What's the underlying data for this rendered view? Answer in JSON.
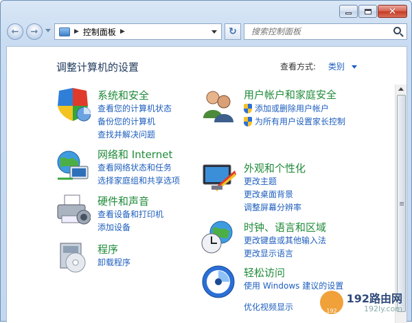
{
  "toolbar": {
    "address_path": "控制面板",
    "search_placeholder": "搜索控制面板"
  },
  "content": {
    "title": "调整计算机的设置",
    "view_by_label": "查看方式:",
    "view_by_value": "类别"
  },
  "categories": {
    "system": {
      "title": "系统和安全",
      "links": [
        "查看您的计算机状态",
        "备份您的计算机",
        "查找并解决问题"
      ]
    },
    "network": {
      "title": "网络和 Internet",
      "links": [
        "查看网络状态和任务",
        "选择家庭组和共享选项"
      ]
    },
    "hardware": {
      "title": "硬件和声音",
      "links": [
        "查看设备和打印机",
        "添加设备"
      ]
    },
    "programs": {
      "title": "程序",
      "links": [
        "卸载程序"
      ]
    },
    "users": {
      "title": "用户帐户和家庭安全",
      "links": [
        "添加或删除用户帐户",
        "为所有用户设置家长控制"
      ]
    },
    "appearance": {
      "title": "外观和个性化",
      "links": [
        "更改主题",
        "更改桌面背景",
        "调整屏幕分辨率"
      ]
    },
    "clock": {
      "title": "时钟、语言和区域",
      "links": [
        "更改键盘或其他输入法",
        "更改显示语言"
      ]
    },
    "ease": {
      "title": "轻松访问",
      "links": [
        "使用 Windows 建议的设置",
        "优化视频显示"
      ]
    }
  },
  "watermark": {
    "brand": "192路由网",
    "url": "192ly.com",
    "badge": "192"
  },
  "icons": {
    "system": "shield-icon",
    "network": "globe-network-icon",
    "hardware": "printer-icon",
    "programs": "program-box-icon",
    "users": "users-icon",
    "appearance": "monitor-paint-icon",
    "clock": "clock-globe-icon",
    "ease": "ease-of-access-icon"
  }
}
